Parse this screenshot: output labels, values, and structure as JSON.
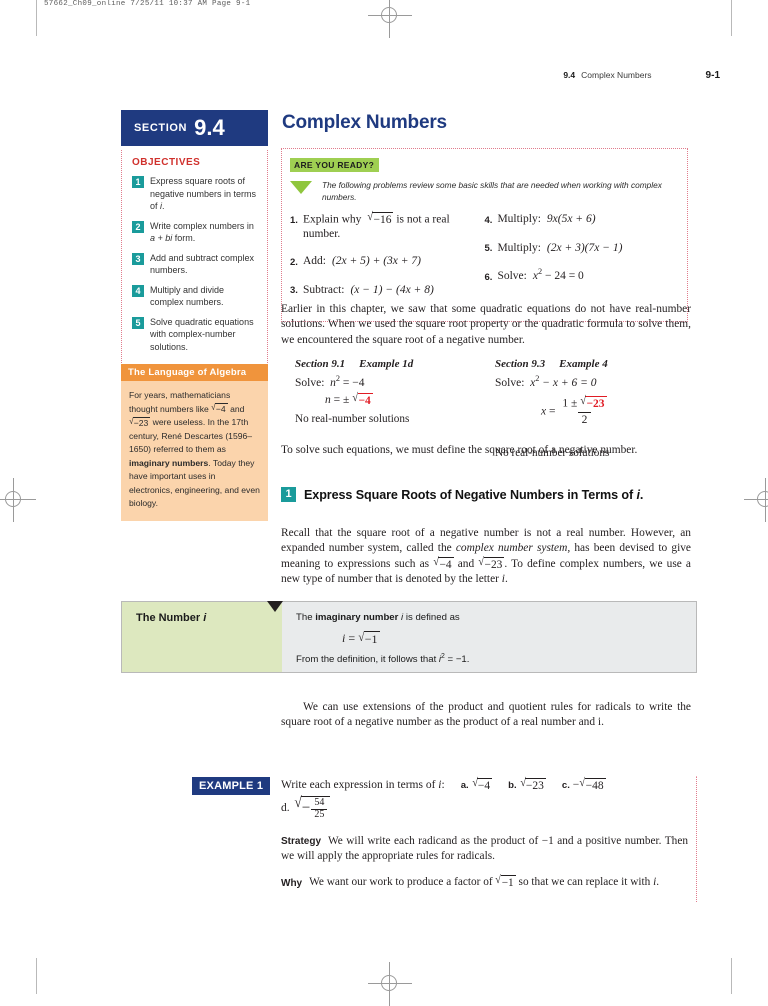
{
  "prepress": {
    "header": "57662_Ch09_online  7/25/11  10:37 AM  Page 9-1"
  },
  "running_head": {
    "section_number": "9.4",
    "section_title": "Complex Numbers",
    "page_number": "9-1"
  },
  "section_header": {
    "word": "SECTION",
    "number": "9.4",
    "title": "Complex Numbers"
  },
  "objectives": {
    "title": "OBJECTIVES",
    "items": [
      {
        "num": "1",
        "text_1": "Express square roots of negative numbers in terms of ",
        "text_italic": "i",
        "text_2": "."
      },
      {
        "num": "2",
        "text_1": "Write complex numbers in ",
        "text_italic": "a + bi",
        "text_2": " form."
      },
      {
        "num": "3",
        "text_1": "Add and subtract complex numbers.",
        "text_italic": "",
        "text_2": ""
      },
      {
        "num": "4",
        "text_1": "Multiply and divide complex numbers.",
        "text_italic": "",
        "text_2": ""
      },
      {
        "num": "5",
        "text_1": "Solve quadratic equations with complex-number solutions.",
        "text_italic": "",
        "text_2": ""
      }
    ]
  },
  "language_of_algebra": {
    "heading": "The Language of Algebra",
    "body_1": "For years, mathematicians thought numbers like ",
    "radicand_1": "−4",
    "body_2": " and ",
    "radicand_2": "−23",
    "body_3": " were useless. In the 17th century, René Descartes (1596–1650) referred to them as ",
    "bold_term": "imaginary numbers",
    "body_4": ". Today they have important uses in electronics, engineering, and even biology."
  },
  "are_you_ready": {
    "banner": "ARE YOU READY?",
    "intro": "The following problems review some basic skills that are needed when working with complex numbers.",
    "left_column": [
      {
        "num": "1.",
        "label": "Explain why",
        "expr_pre": "",
        "radicand": "−16",
        "expr_post": "is not a real number."
      },
      {
        "num": "2.",
        "label": "Add:",
        "expr": "(2x + 5) + (3x + 7)"
      },
      {
        "num": "3.",
        "label": "Subtract:",
        "expr": "(x − 1) − (4x + 8)"
      }
    ],
    "right_column": [
      {
        "num": "4.",
        "label": "Multiply:",
        "expr": "9x(5x + 6)"
      },
      {
        "num": "5.",
        "label": "Multiply:",
        "expr": "(2x + 3)(7x − 1)"
      },
      {
        "num": "6.",
        "label": "Solve:",
        "expr_a": "x",
        "expr_sup": "2",
        "expr_b": " − 24 = 0"
      }
    ]
  },
  "intro_paragraph": "Earlier in this chapter, we saw that some quadratic equations do not have real-number solutions. When we used the square root property or the quadratic formula to solve them, we encountered the square root of a negative number.",
  "worked_examples": {
    "left": {
      "section": "Section 9.1",
      "example": "Example 1d",
      "line1_label": "Solve:",
      "line1_var": "n",
      "line1_sup": "2",
      "line1_rhs": " = −4",
      "line2_var": "n",
      "line2_op": " = ±",
      "line2_radicand": "−4",
      "note": "No real-number solutions"
    },
    "right": {
      "section": "Section 9.3",
      "example": "Example 4",
      "line1_label": "Solve:",
      "line1_var": "x",
      "line1_sup": "2",
      "line1_rhs": " − x + 6 = 0",
      "frac_var": "x",
      "frac_eq": " = ",
      "frac_num_pre": "1 ± ",
      "frac_num_radicand": "−23",
      "frac_den": "2",
      "note": "No real-number solutions"
    }
  },
  "transition_paragraph": "To solve such equations, we must define the square root of a negative number.",
  "objective_heading": {
    "badge": "1",
    "text_pre": "Express Square Roots of Negative Numbers in Terms of ",
    "text_italic": "i",
    "text_post": "."
  },
  "recall_paragraph": {
    "part_1": "Recall that the square root of a negative number is not a real number. However, an expanded number system, called the ",
    "italic_term": "complex number system,",
    "part_2": " has been devised to give meaning to expressions such as ",
    "radicand_1": "−4",
    "part_3": " and ",
    "radicand_2": "−23",
    "part_4": ". To define complex numbers, we use a new type of number that is denoted by the letter ",
    "part_italic": "i",
    "part_5": "."
  },
  "definition_box": {
    "label_pre": "The Number ",
    "label_italic": "i",
    "line_1_pre": "The ",
    "line_1_bold": "imaginary number",
    "line_1_italic": " i ",
    "line_1_post": "is defined as",
    "equation_var": "i",
    "equation_eq": " = ",
    "equation_radicand": "−1",
    "line_2_pre": "From the definition, it follows that ",
    "line_2_var": "i",
    "line_2_sup": "2",
    "line_2_post": " = −1."
  },
  "extension_paragraph": "We can use extensions of the product and quotient rules for radicals to write the square root of a negative number as the product of a real number and i.",
  "example_1": {
    "tag": "EXAMPLE 1",
    "prompt_pre": "Write each expression in terms of ",
    "prompt_italic": "i",
    "prompt_colon": ":",
    "parts": [
      {
        "letter": "a.",
        "radicand": "−4",
        "prefix": ""
      },
      {
        "letter": "b.",
        "radicand": "−23",
        "prefix": ""
      },
      {
        "letter": "c.",
        "radicand": "−48",
        "prefix": "−"
      }
    ],
    "part_d": {
      "letter": "d.",
      "sign": "−",
      "numerator": "54",
      "denominator": "25"
    },
    "strategy_label": "Strategy",
    "strategy_text": "We will write each radicand as the product of −1 and a positive number. Then we will apply the appropriate rules for radicals.",
    "why_label": "Why",
    "why_text_pre": "We want our work to produce a factor of ",
    "why_radicand": "−1",
    "why_text_post": " so that we can replace it with ",
    "why_italic": "i",
    "why_text_end": "."
  },
  "colors": {
    "navy": "#1f3a80",
    "teal": "#1a9b9b",
    "red": "#d0312d",
    "green_banner": "#9fcf52",
    "orange": "#f0943c",
    "orange_light": "#fbd4ac",
    "def_label_green": "#dde8bf",
    "def_body_gray": "#e9ebec",
    "math_red": "#e01b24"
  }
}
